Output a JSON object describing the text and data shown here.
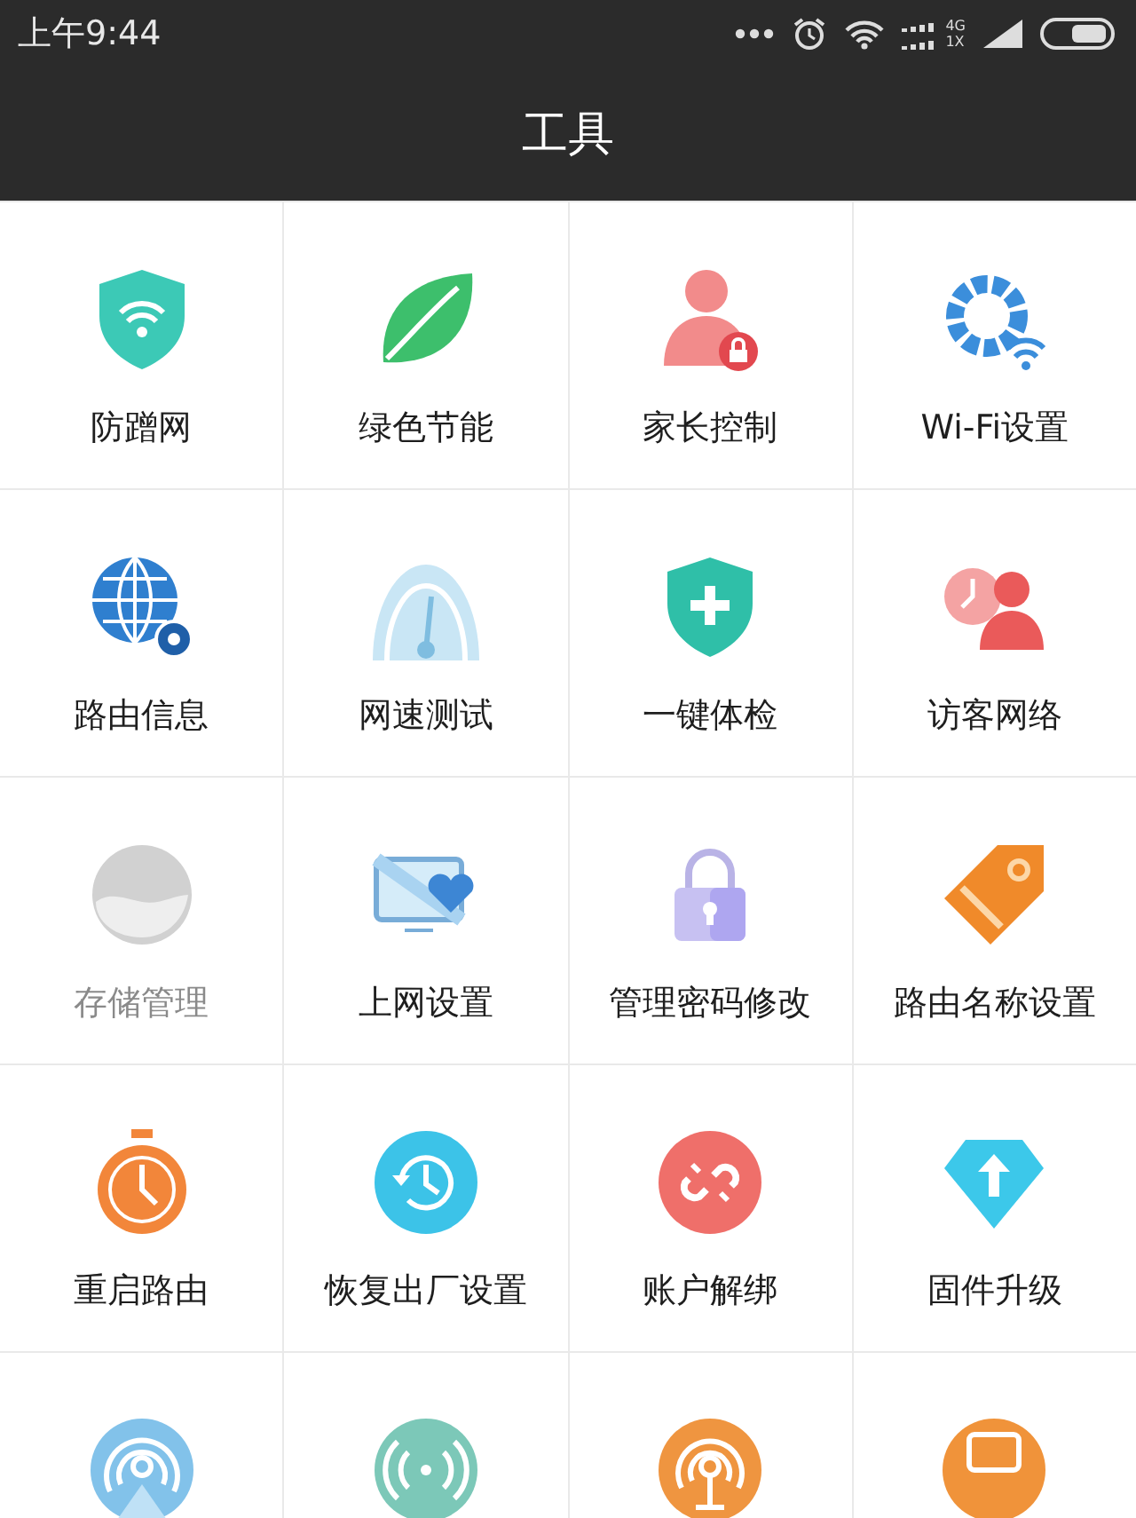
{
  "status_bar": {
    "time": "上午9:44",
    "network_top": "4G",
    "network_bottom": "1X"
  },
  "title_bar": {
    "title": "工具"
  },
  "tools": [
    {
      "kind": "shield-wifi",
      "label": "防蹭网",
      "disabled": false
    },
    {
      "kind": "leaf",
      "label": "绿色节能",
      "disabled": false
    },
    {
      "kind": "person-lock",
      "label": "家长控制",
      "disabled": false
    },
    {
      "kind": "gear-wifi",
      "label": "Wi-Fi设置",
      "disabled": false
    },
    {
      "kind": "globe-gear",
      "label": "路由信息",
      "disabled": false
    },
    {
      "kind": "speedometer",
      "label": "网速测试",
      "disabled": false
    },
    {
      "kind": "shield-plus",
      "label": "一键体检",
      "disabled": false
    },
    {
      "kind": "clock-person",
      "label": "访客网络",
      "disabled": false
    },
    {
      "kind": "disk",
      "label": "存储管理",
      "disabled": true
    },
    {
      "kind": "monitor-heart",
      "label": "上网设置",
      "disabled": false
    },
    {
      "kind": "padlock",
      "label": "管理密码修改",
      "disabled": false
    },
    {
      "kind": "tag",
      "label": "路由名称设置",
      "disabled": false
    },
    {
      "kind": "stopwatch",
      "label": "重启路由",
      "disabled": false
    },
    {
      "kind": "history",
      "label": "恢复出厂设置",
      "disabled": false
    },
    {
      "kind": "unlink",
      "label": "账户解绑",
      "disabled": false
    },
    {
      "kind": "diamond-arrow",
      "label": "固件升级",
      "disabled": false
    },
    {
      "kind": "broadcast",
      "disabled": false
    },
    {
      "kind": "radio-wave",
      "disabled": false
    },
    {
      "kind": "antenna",
      "disabled": false
    },
    {
      "kind": "coin-screen",
      "disabled": false
    }
  ]
}
